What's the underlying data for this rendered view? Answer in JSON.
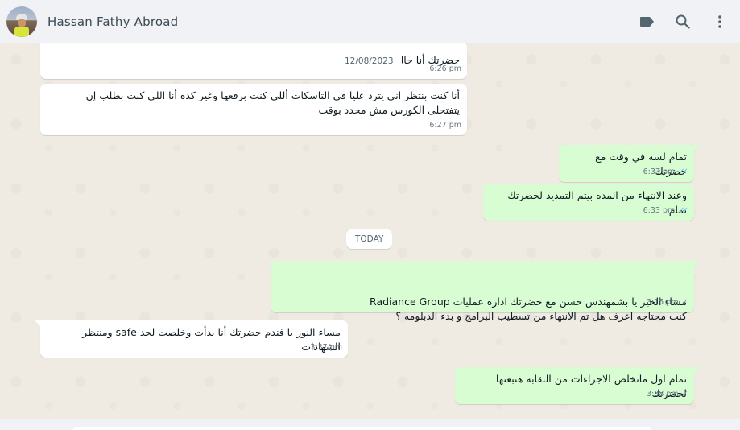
{
  "header": {
    "contact_name": "Hassan Fathy Abroad",
    "icons": [
      "label-icon",
      "search-icon",
      "kebab-menu-icon"
    ]
  },
  "date_separators": {
    "floating": "12/08/2023",
    "today": "TODAY"
  },
  "messages": [
    {
      "direction": "in",
      "text": "حضرتك أنا حاليا",
      "time": "6:26 pm"
    },
    {
      "direction": "in",
      "text": "أنا كنت بنتظر انى يترد عليا فى التاسكات أللى كنت برفعها وغير كده أنا اللى كنت بطلب إن يتفتحلى الكورس مش محدد بوقت",
      "time": "6:27 pm"
    },
    {
      "direction": "out",
      "text": "تمام لسه في وقت مع حضرتك",
      "time": "6:33 pm",
      "status": "read"
    },
    {
      "direction": "out",
      "text": "وعند الانتهاء من المده بيتم التمديد لحضرتك تمام",
      "time": "6:33 pm",
      "status": "read"
    },
    {
      "direction": "out",
      "text": "مساء الخير يا بشمهندس حسن  مع حضرتك اداره عمليات Radiance Group\nكنت محتاجه اعرف هل تم الانتهاء من تسطيب البرامج و بدء الدبلومه  ؟",
      "time": "3:15 pm",
      "status": "sent"
    },
    {
      "direction": "in",
      "text": "مساء النور يا فندم حضرتك أنا بدأت وخلصت لحد safe ومنتظر الشهادات",
      "time": "3:37 pm"
    },
    {
      "direction": "out",
      "text": "تمام اول ماتخلص الاجراءات من النقابه هنبعتها لحضرتك",
      "time": "3:38 pm",
      "status": "sent"
    }
  ],
  "colors": {
    "incoming_bubble": "#ffffff",
    "outgoing_bubble": "#d9fdd3",
    "read_tick": "#53bdeb",
    "sent_tick": "#8696a0",
    "chat_background": "#efeae2"
  }
}
